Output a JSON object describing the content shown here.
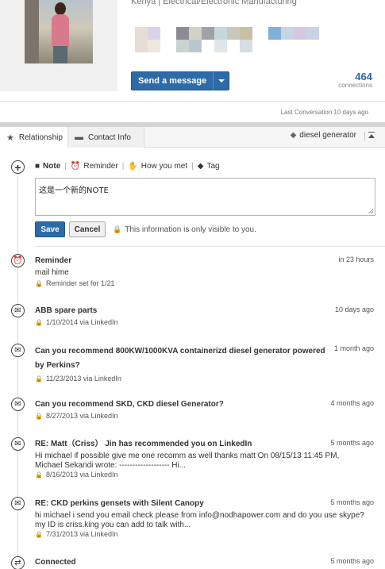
{
  "profile": {
    "industry": "Kenya | Electrical/Electronic Manufacturing",
    "send_message": "Send a message",
    "connections_count": "464",
    "connections_label": "connections",
    "last_conversation": "Last Conversation 10 days ago"
  },
  "tabs": {
    "relationship": "Relationship",
    "contact_info": "Contact Info",
    "tag_filter": "diesel generator"
  },
  "actions": {
    "note": "Note",
    "reminder": "Reminder",
    "how_you_met": "How you met",
    "tag": "Tag"
  },
  "note_editor": {
    "value": "这是一个新的NOTE",
    "save": "Save",
    "cancel": "Cancel",
    "privacy": "This information is only visible to you."
  },
  "timeline": [
    {
      "icon": "alarm-clock-icon",
      "title": "Reminder",
      "time": "in 23 hours",
      "body": "mail hime",
      "meta": "Reminder set for 1/21"
    },
    {
      "icon": "mail-icon",
      "title": "ABB spare parts",
      "time": "10 days ago",
      "body": "",
      "meta": "1/10/2014 via LinkedIn"
    },
    {
      "icon": "mail-icon",
      "title": "Can you recommend 800KW/1000KVA containerizd diesel generator powered by Perkins?",
      "time": "1 month ago",
      "body": "",
      "meta": "11/23/2013 via LinkedIn"
    },
    {
      "icon": "mail-icon",
      "title": "Can you recommend SKD, CKD diesel Generator?",
      "time": "4 months ago",
      "body": "",
      "meta": "8/27/2013 via LinkedIn"
    },
    {
      "icon": "mail-icon",
      "title": "RE: Matt（Criss） Jin has recommended you on LinkedIn",
      "time": "5 months ago",
      "body": "Hi michael if possible give me one recomm as well thanks matt On 08/15/13 11:45 PM, Michael Sekandi wrote: ------------------- Hi...",
      "meta": "8/16/2013 via LinkedIn"
    },
    {
      "icon": "mail-icon",
      "title": "RE: CKD perkins gensets with Silent Canopy",
      "time": "5 months ago",
      "body": "hi michael i send you email check please from info@nodhapower.com and do you use skype? my ID is criss.king you can add to talk with...",
      "meta": "7/31/2013 via LinkedIn"
    },
    {
      "icon": "connected-icon",
      "title": "Connected",
      "time": "5 months ago",
      "body": "",
      "meta": ""
    }
  ],
  "colors": {
    "primary_button": "#2d6ba8",
    "connections_number": "#2a69a8"
  }
}
